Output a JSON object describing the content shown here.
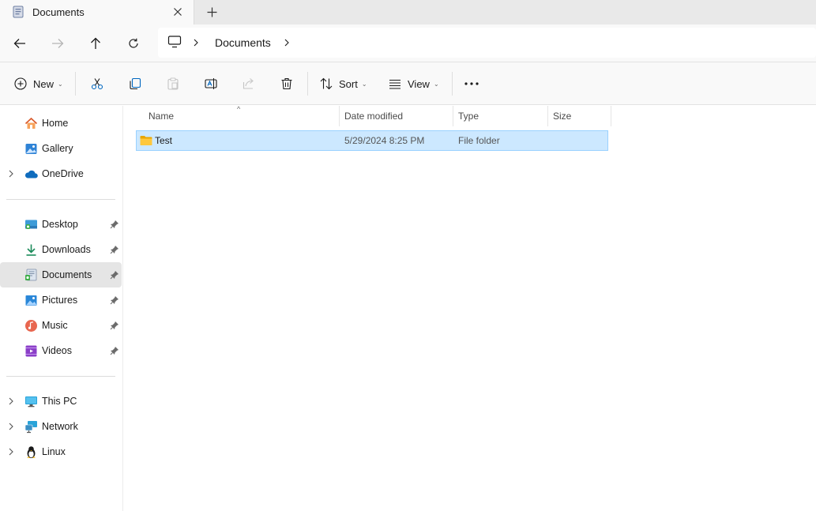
{
  "window": {
    "tab_title": "Documents",
    "tab_icon": "documents-icon",
    "close_icon": "close-icon",
    "new_tab_icon": "plus-icon"
  },
  "navigation": {
    "back_icon": "arrow-left-icon",
    "forward_icon": "arrow-right-icon",
    "up_icon": "arrow-up-icon",
    "refresh_icon": "refresh-icon",
    "breadcrumb": [
      "Documents"
    ],
    "root_icon": "this-pc-icon"
  },
  "toolbar": {
    "new_label": "New",
    "sort_label": "Sort",
    "view_label": "View",
    "icons": [
      "cut-icon",
      "copy-icon",
      "paste-icon",
      "rename-icon",
      "share-icon",
      "delete-icon",
      "more-icon"
    ]
  },
  "sidebar": {
    "quick": [
      {
        "label": "Home",
        "icon": "home-icon"
      },
      {
        "label": "Gallery",
        "icon": "gallery-icon"
      },
      {
        "label": "OneDrive",
        "icon": "onedrive-icon",
        "expandable": true
      }
    ],
    "pinned": [
      {
        "label": "Desktop",
        "icon": "desktop-icon"
      },
      {
        "label": "Downloads",
        "icon": "downloads-icon"
      },
      {
        "label": "Documents",
        "icon": "documents-icon",
        "selected": true
      },
      {
        "label": "Pictures",
        "icon": "pictures-icon"
      },
      {
        "label": "Music",
        "icon": "music-icon"
      },
      {
        "label": "Videos",
        "icon": "videos-icon"
      }
    ],
    "locations": [
      {
        "label": "This PC",
        "icon": "this-pc-icon"
      },
      {
        "label": "Network",
        "icon": "network-icon"
      },
      {
        "label": "Linux",
        "icon": "linux-icon"
      }
    ]
  },
  "file_list": {
    "columns": [
      "Name",
      "Date modified",
      "Type",
      "Size"
    ],
    "sorted_by": "Name",
    "rows": [
      {
        "name": "Test",
        "date_modified": "5/29/2024 8:25 PM",
        "type": "File folder",
        "size": "",
        "icon": "folder-icon",
        "selected": true
      }
    ]
  },
  "colors": {
    "selection_fill": "#cce8ff",
    "selection_border": "#99d1ff",
    "sidebar_selected": "#e5e5e5",
    "accent": "#0067c0"
  }
}
